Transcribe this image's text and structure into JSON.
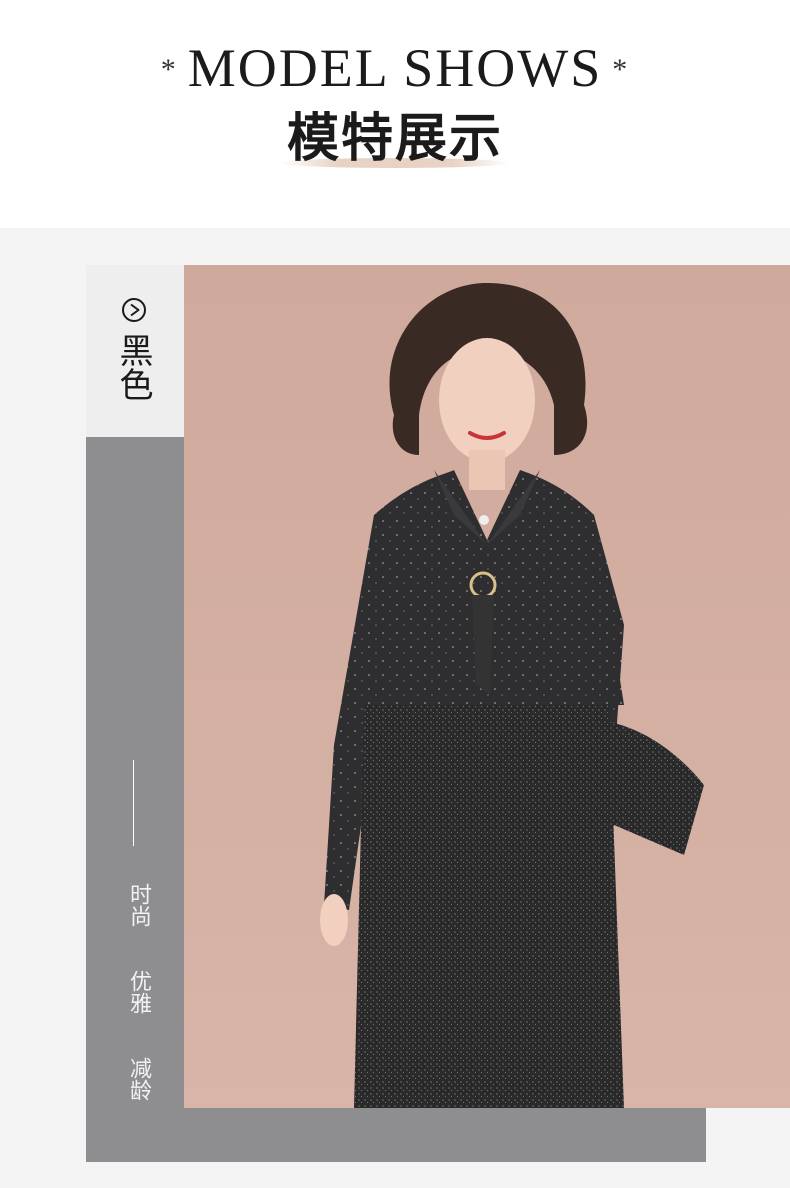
{
  "header": {
    "title_en": "MODEL SHOWS",
    "title_cn": "模特展示",
    "star_left": "*",
    "star_right": "*"
  },
  "color_tag": {
    "icon": "play-circle-icon",
    "label": "黑色"
  },
  "features": [
    "时尚",
    "优雅",
    "减龄"
  ],
  "photo": {
    "subject": "model-in-black-dress"
  },
  "colors": {
    "panel_gray": "#8e8e91",
    "section_bg": "#f4f4f4",
    "photo_bg": "#c9a59a",
    "dress": "#2c2c2c"
  }
}
